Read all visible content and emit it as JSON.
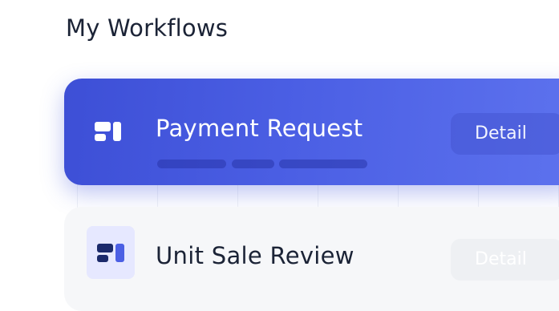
{
  "page": {
    "title": "My Workflows"
  },
  "workflows": [
    {
      "name": "Payment Request",
      "action_label": "Detail",
      "state": "active",
      "icon": "workflow-blocks-icon",
      "accent_color": "#4b5fe4"
    },
    {
      "name": "Unit Sale Review",
      "action_label": "Detail",
      "state": "inactive",
      "icon": "workflow-blocks-icon",
      "accent_color": "#1b2a6b"
    }
  ],
  "colors": {
    "primary": "#4b5fe4",
    "text_dark": "#1b2336",
    "card_muted": "#f6f7f9"
  }
}
